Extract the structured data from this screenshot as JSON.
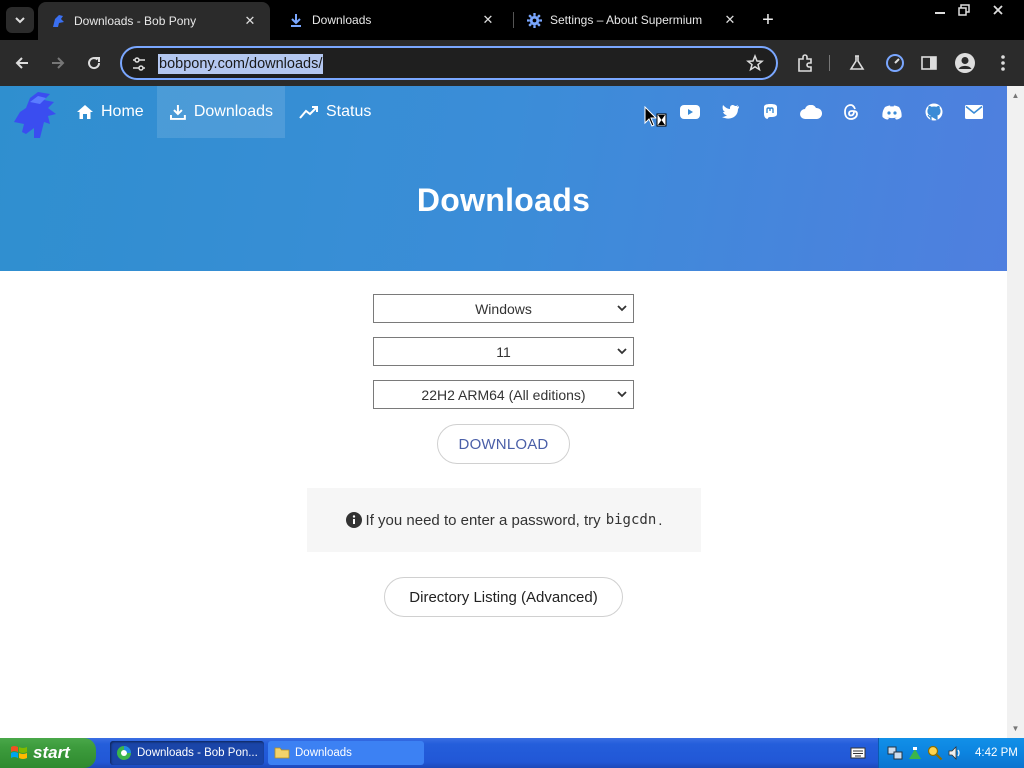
{
  "browser": {
    "tabs": [
      {
        "title": "Downloads - Bob Pony",
        "icon": "bobpony-favicon",
        "active": true
      },
      {
        "title": "Downloads",
        "icon": "download-icon",
        "active": false
      },
      {
        "title": "Settings – About Supermium",
        "icon": "gear-icon",
        "active": false
      }
    ],
    "address": "bobpony.com/downloads/"
  },
  "page": {
    "nav": {
      "home": "Home",
      "downloads": "Downloads",
      "status": "Status"
    },
    "social_icons": [
      "youtube-icon",
      "twitter-icon",
      "mastodon-icon",
      "cloud-icon",
      "threads-icon",
      "discord-icon",
      "github-icon",
      "mail-icon"
    ],
    "hero_title": "Downloads",
    "selects": {
      "os": "Windows",
      "version": "11",
      "build": "22H2 ARM64 (All editions)"
    },
    "download_button": "DOWNLOAD",
    "notice": {
      "prefix": "If you need to enter a password, try",
      "code": "bigcdn",
      "suffix": "."
    },
    "directory_button": "Directory Listing (Advanced)"
  },
  "taskbar": {
    "start_label": "start",
    "tasks": [
      {
        "label": "Downloads - Bob Pon...",
        "active": true
      },
      {
        "label": "Downloads",
        "active": false
      }
    ],
    "clock": "4:42 PM"
  },
  "colors": {
    "hero_start": "#2f8fcf",
    "hero_end": "#4f7fdf",
    "download_text": "#4a5fa8"
  }
}
